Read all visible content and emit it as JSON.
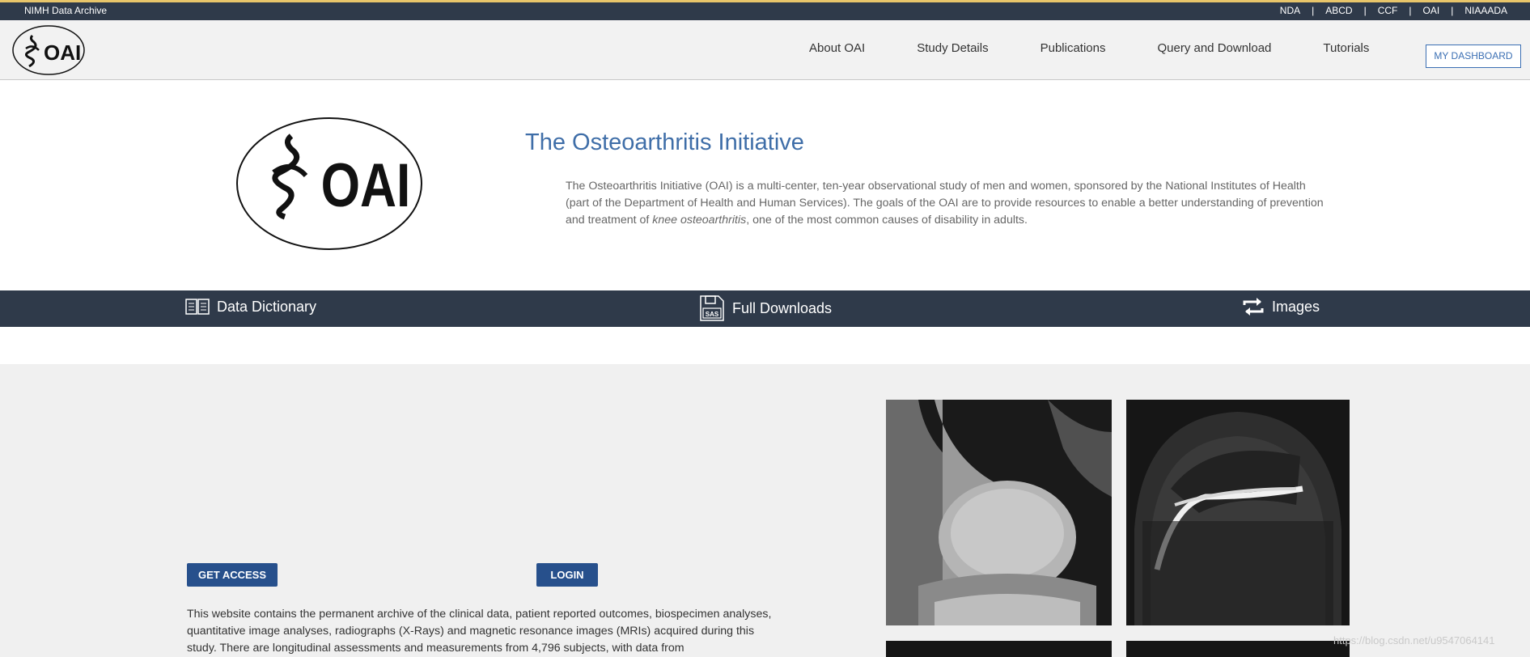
{
  "topbar": {
    "brand": "NIMH Data Archive",
    "links": [
      "NDA",
      "ABCD",
      "CCF",
      "OAI",
      "NIAAADA"
    ],
    "separator": "|"
  },
  "nav": {
    "logo_alt": "OAI",
    "items": [
      "About OAI",
      "Study Details",
      "Publications",
      "Query and Download",
      "Tutorials"
    ],
    "dashboard_label": "MY DASHBOARD"
  },
  "hero": {
    "title": "The Osteoarthritis Initiative",
    "text_before": "The Osteoarthritis Initiative (OAI) is a multi-center, ten-year observational study of men and women, sponsored by the National Institutes of Health (part of the Department of Health and Human Services). The goals of the OAI are to provide resources to enable a better understanding of prevention and treatment of ",
    "text_em": "knee osteoarthritis",
    "text_after": ", one of the most common causes of disability in adults."
  },
  "band": {
    "data_dictionary": "Data Dictionary",
    "full_downloads": "Full Downloads",
    "images": "Images",
    "sas_label": "SAS"
  },
  "lower": {
    "get_access": "GET ACCESS",
    "login": "LOGIN",
    "description": "This website contains the permanent archive of the clinical data, patient reported outcomes, biospecimen analyses, quantitative image analyses, radiographs (X-Rays) and magnetic resonance images (MRIs) acquired during this study. There are longitudinal assessments and measurements from 4,796 subjects, with data from"
  },
  "watermark": "https://blog.csdn.net/u9547064141",
  "colors": {
    "dark_bar": "#2f3a4a",
    "accent_blue": "#3f6ea8",
    "button_blue": "#27508c",
    "top_border": "#e8c56a"
  }
}
